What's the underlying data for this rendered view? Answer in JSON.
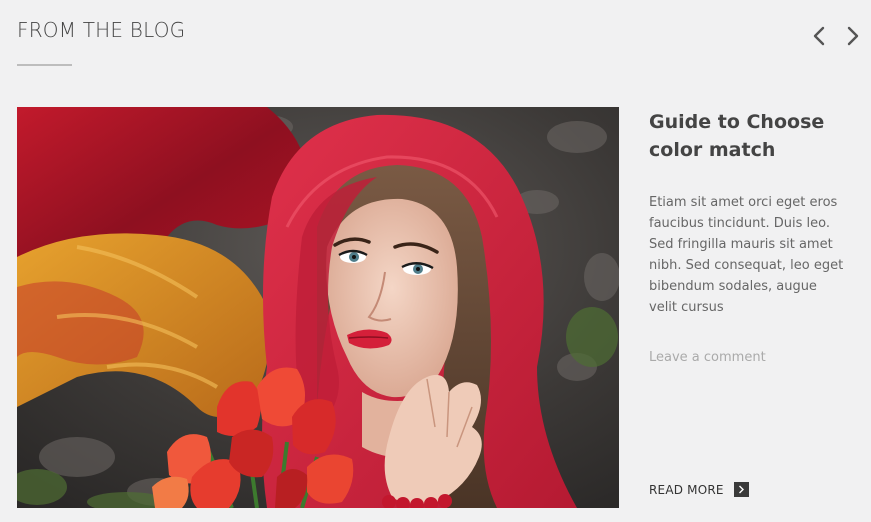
{
  "section": {
    "title": "FROM THE BLOG"
  },
  "navigation": {
    "prev_icon": "chevron-left-icon",
    "next_icon": "chevron-right-icon"
  },
  "post": {
    "image_description": "woman-in-red-headscarf-holding-red-tulips",
    "title": "Guide to Choose color match",
    "excerpt": "Etiam sit amet orci eget eros faucibus tincidunt. Duis leo. Sed fringilla mauris sit amet nibh. Sed consequat, leo eget bibendum sodales, augue velit cursus",
    "comment_link": "Leave a comment",
    "read_more_label": "READ MORE",
    "read_more_icon": "chevron-right-icon"
  },
  "colors": {
    "background": "#f1f1f2",
    "heading": "#444444",
    "text": "#666666",
    "muted": "#aaaaaa",
    "accent_dark": "#3a3a3a"
  }
}
